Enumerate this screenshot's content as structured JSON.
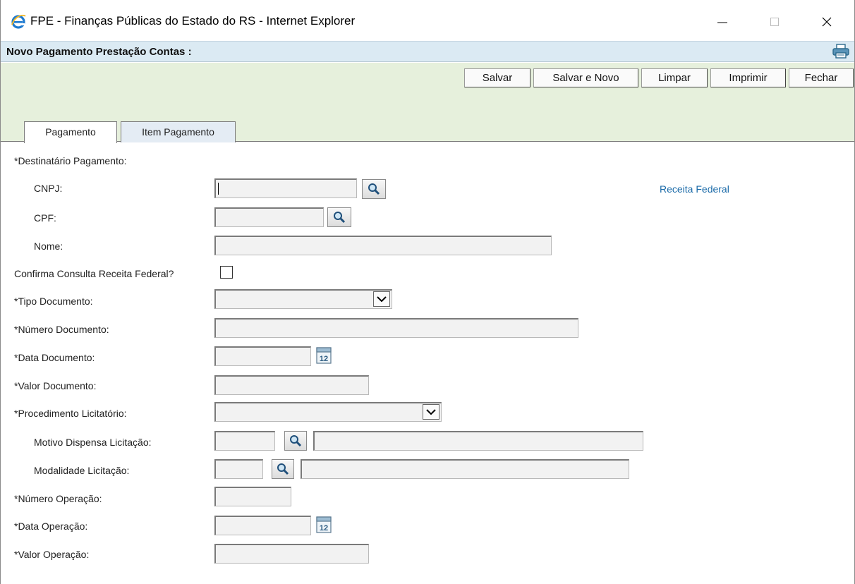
{
  "window": {
    "title": "FPE - Finanças Públicas do Estado do RS - Internet Explorer"
  },
  "header": {
    "title": "Novo Pagamento Prestação Contas :"
  },
  "toolbar": {
    "salvar": "Salvar",
    "salvar_e_novo": "Salvar e Novo",
    "limpar": "Limpar",
    "imprimir": "Imprimir",
    "fechar": "Fechar"
  },
  "tabs": [
    {
      "label": "Pagamento",
      "active": true
    },
    {
      "label": "Item Pagamento",
      "active": false
    }
  ],
  "form": {
    "destinatario_label": "*Destinatário Pagamento:",
    "cnpj_label": "CNPJ:",
    "cnpj_value": "",
    "cpf_label": "CPF:",
    "cpf_value": "",
    "nome_label": "Nome:",
    "nome_value": "",
    "receita_link": "Receita Federal",
    "confirma_label": "Confirma Consulta Receita Federal?",
    "confirma_checked": false,
    "tipo_doc_label": "*Tipo Documento:",
    "tipo_doc_value": "",
    "numero_doc_label": "*Número Documento:",
    "numero_doc_value": "",
    "data_doc_label": "*Data Documento:",
    "data_doc_value": "",
    "valor_doc_label": "*Valor Documento:",
    "valor_doc_value": "",
    "proc_licit_label": "*Procedimento Licitatório:",
    "proc_licit_value": "",
    "motivo_label": "Motivo Dispensa Licitação:",
    "motivo_code": "",
    "motivo_desc": "",
    "modalidade_label": "Modalidade Licitação:",
    "modalidade_code": "",
    "modalidade_desc": "",
    "numero_op_label": "*Número Operação:",
    "numero_op_value": "",
    "data_op_label": "*Data Operação:",
    "data_op_value": "",
    "valor_op_label": "*Valor Operação:",
    "valor_op_value": ""
  },
  "calendar_icon_text": "12",
  "colors": {
    "header_bg": "#dbeaf3",
    "toolbar_bg": "#e6f0dc",
    "link": "#1a6aa8",
    "ie_blue": "#1e7ad0"
  }
}
